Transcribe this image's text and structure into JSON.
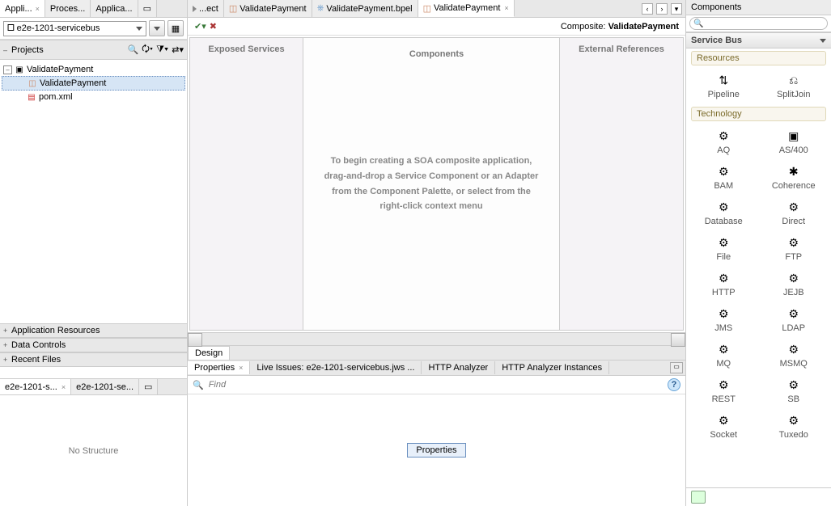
{
  "left": {
    "tabs": [
      "Appli...",
      "Proces...",
      "Applica..."
    ],
    "activeTab": 0,
    "appDropdown": "e2e-1201-servicebus",
    "projectsHeader": "Projects",
    "tree": {
      "root": "ValidatePayment",
      "children": [
        "ValidatePayment",
        "pom.xml"
      ],
      "selectedIndex": 0
    },
    "collapsibleSections": [
      "Application Resources",
      "Data Controls",
      "Recent Files"
    ],
    "lowerTabs": [
      "e2e-1201-s...",
      "e2e-1201-se..."
    ],
    "structureEmpty": "No Structure"
  },
  "center": {
    "editorTabs": [
      {
        "label": "...ect",
        "icon": "file"
      },
      {
        "label": "ValidatePayment",
        "icon": "composite"
      },
      {
        "label": "ValidatePayment.bpel",
        "icon": "bpel"
      },
      {
        "label": "ValidatePayment",
        "icon": "composite",
        "active": true
      }
    ],
    "compositeLabelPrefix": "Composite: ",
    "compositeName": "ValidatePayment",
    "lanes": {
      "exposed": "Exposed Services",
      "components": "Components",
      "external": "External References"
    },
    "placeholder": "To begin creating a SOA composite application, drag-and-drop a Service Component or an Adapter from the Component Palette, or select from the right-click context menu",
    "designTab": "Design",
    "bottomTabs": [
      "Properties",
      "Live Issues: e2e-1201-servicebus.jws ...",
      "HTTP Analyzer",
      "HTTP Analyzer Instances"
    ],
    "findPlaceholder": "Find",
    "propertiesBadge": "Properties"
  },
  "right": {
    "header": "Components",
    "sectionHeader": "Service Bus",
    "groups": [
      {
        "title": "Resources",
        "items": [
          {
            "label": "Pipeline",
            "icon": "⇅"
          },
          {
            "label": "SplitJoin",
            "icon": "⎌"
          }
        ]
      },
      {
        "title": "Technology",
        "items": [
          {
            "label": "AQ",
            "icon": "⚙"
          },
          {
            "label": "AS/400",
            "icon": "▣"
          },
          {
            "label": "BAM",
            "icon": "⚙"
          },
          {
            "label": "Coherence",
            "icon": "✱"
          },
          {
            "label": "Database",
            "icon": "⚙"
          },
          {
            "label": "Direct",
            "icon": "⚙"
          },
          {
            "label": "File",
            "icon": "⚙"
          },
          {
            "label": "FTP",
            "icon": "⚙"
          },
          {
            "label": "HTTP",
            "icon": "⚙"
          },
          {
            "label": "JEJB",
            "icon": "⚙"
          },
          {
            "label": "JMS",
            "icon": "⚙"
          },
          {
            "label": "LDAP",
            "icon": "⚙"
          },
          {
            "label": "MQ",
            "icon": "⚙"
          },
          {
            "label": "MSMQ",
            "icon": "⚙"
          },
          {
            "label": "REST",
            "icon": "⚙"
          },
          {
            "label": "SB",
            "icon": "⚙"
          },
          {
            "label": "Socket",
            "icon": "⚙"
          },
          {
            "label": "Tuxedo",
            "icon": "⚙"
          }
        ]
      }
    ]
  }
}
